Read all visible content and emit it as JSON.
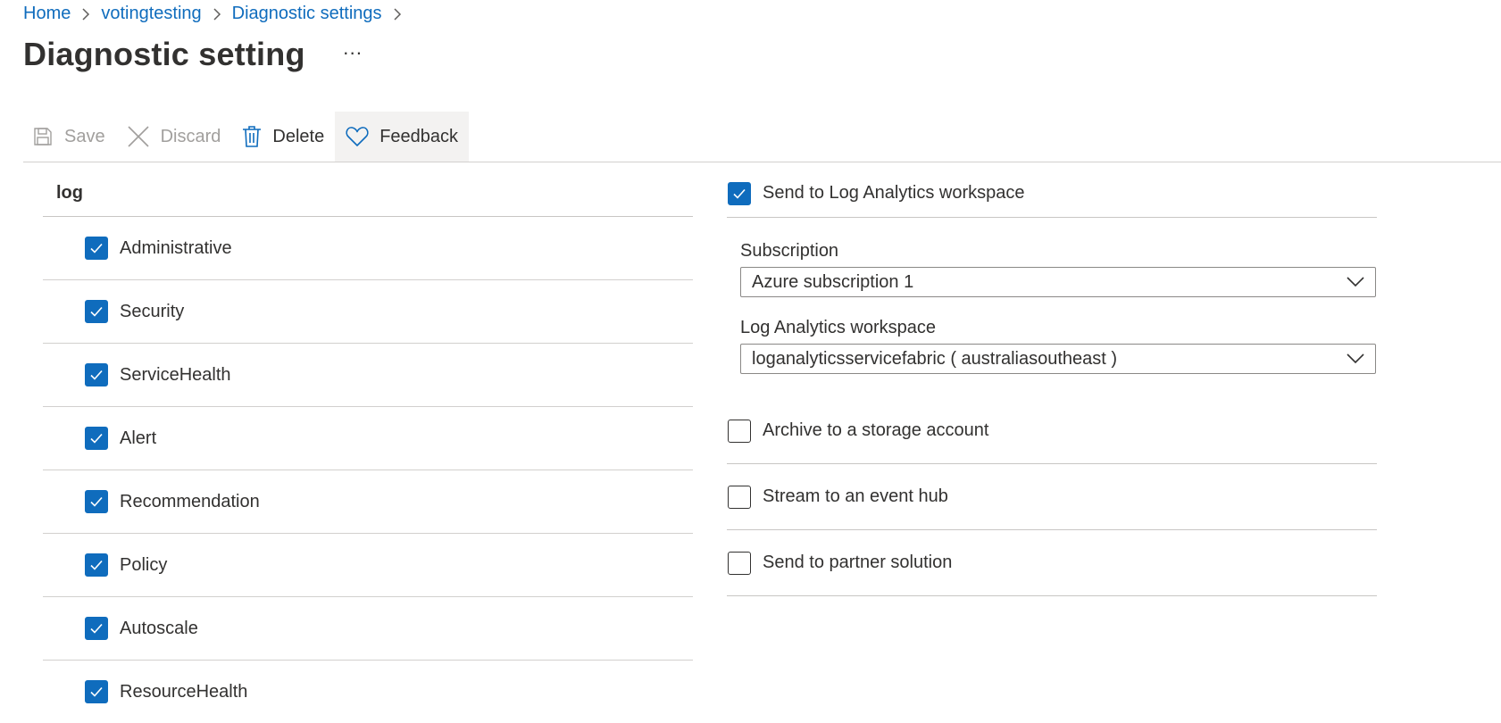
{
  "breadcrumb": {
    "items": [
      {
        "label": "Home"
      },
      {
        "label": "votingtesting"
      },
      {
        "label": "Diagnostic settings"
      }
    ]
  },
  "page": {
    "title": "Diagnostic setting",
    "more_label": "···"
  },
  "toolbar": {
    "save_label": "Save",
    "discard_label": "Discard",
    "delete_label": "Delete",
    "feedback_label": "Feedback"
  },
  "logs": {
    "header": "log",
    "categories": [
      {
        "label": "Administrative",
        "checked": true
      },
      {
        "label": "Security",
        "checked": true
      },
      {
        "label": "ServiceHealth",
        "checked": true
      },
      {
        "label": "Alert",
        "checked": true
      },
      {
        "label": "Recommendation",
        "checked": true
      },
      {
        "label": "Policy",
        "checked": true
      },
      {
        "label": "Autoscale",
        "checked": true
      },
      {
        "label": "ResourceHealth",
        "checked": true
      }
    ]
  },
  "destinations": {
    "log_analytics": {
      "label": "Send to Log Analytics workspace",
      "checked": true,
      "subscription_label": "Subscription",
      "subscription_value": "Azure subscription 1",
      "workspace_label": "Log Analytics workspace",
      "workspace_value": "loganalyticsservicefabric ( australiasoutheast )"
    },
    "storage": {
      "label": "Archive to a storage account",
      "checked": false
    },
    "event_hub": {
      "label": "Stream to an event hub",
      "checked": false
    },
    "partner": {
      "label": "Send to partner solution",
      "checked": false
    }
  },
  "colors": {
    "accent": "#0f6cbd",
    "text": "#323130",
    "disabled_text": "#a19f9d",
    "divider": "#d2d0ce"
  }
}
